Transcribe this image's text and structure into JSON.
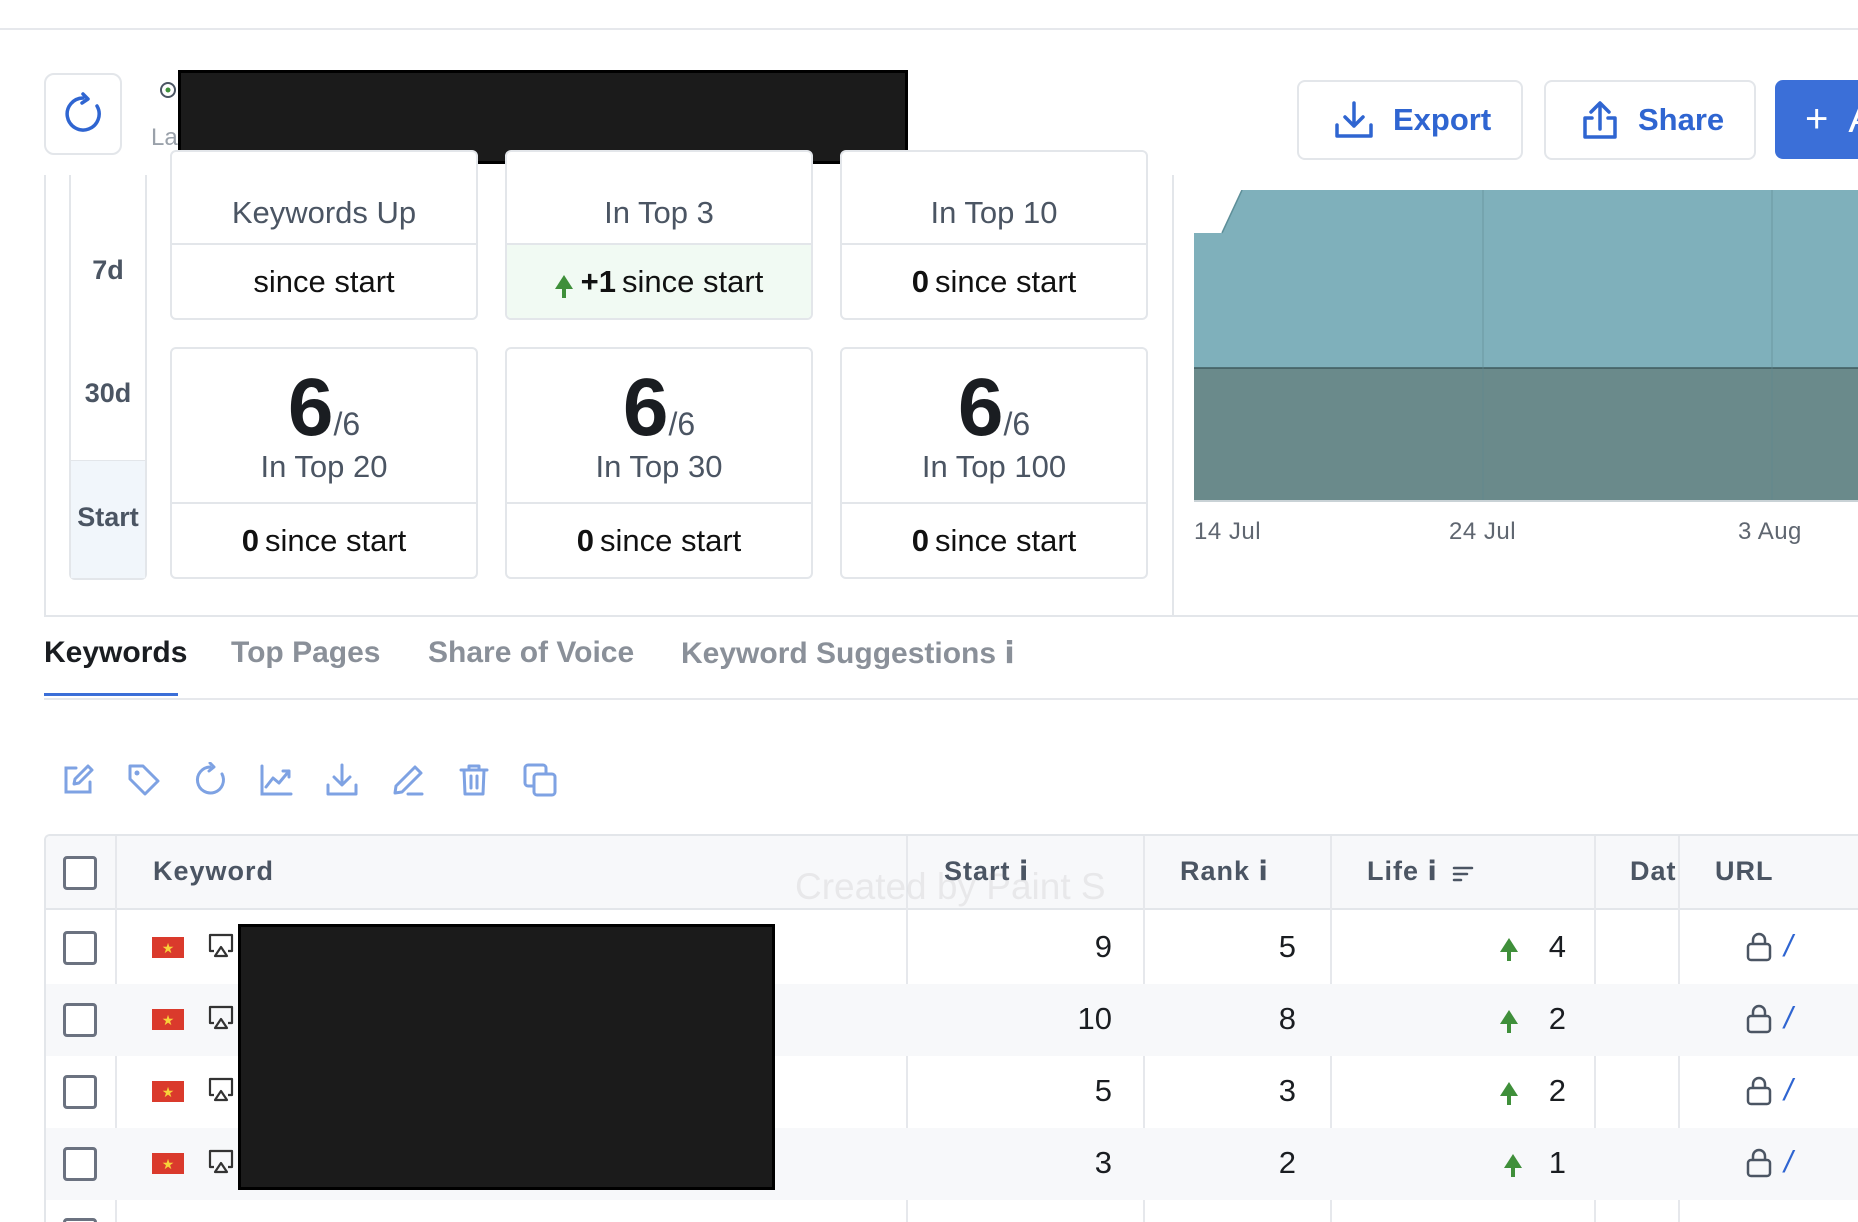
{
  "header": {
    "location_label": "La",
    "export_label": "Export",
    "share_label": "Share",
    "add_label": "A"
  },
  "periods": [
    "7d",
    "30d",
    "Start"
  ],
  "cards_row1": [
    {
      "title": "Keywords Up",
      "foot_value": "",
      "foot_text": "since start",
      "trend": "none"
    },
    {
      "title": "In Top 3",
      "foot_value": "+1",
      "foot_text": "since start",
      "trend": "up"
    },
    {
      "title": "In Top 10",
      "foot_value": "0",
      "foot_text": "since start",
      "trend": "none"
    }
  ],
  "cards_row2": [
    {
      "count": "6",
      "total": "/6",
      "title": "In Top 20",
      "foot_value": "0",
      "foot_text": "since start"
    },
    {
      "count": "6",
      "total": "/6",
      "title": "In Top 30",
      "foot_value": "0",
      "foot_text": "since start"
    },
    {
      "count": "6",
      "total": "/6",
      "title": "In Top 100",
      "foot_value": "0",
      "foot_text": "since start"
    }
  ],
  "chart": {
    "x_labels": [
      "14 Jul",
      "24 Jul",
      "3 Aug"
    ],
    "colors": {
      "upper": "#7fb0bb",
      "lower": "#6a8a8b"
    }
  },
  "tabs": [
    {
      "label": "Keywords",
      "active": true
    },
    {
      "label": "Top Pages",
      "active": false
    },
    {
      "label": "Share of Voice",
      "active": false
    },
    {
      "label": "Keyword Suggestions ⅰ",
      "active": false
    }
  ],
  "toolbar": [
    "edit-icon",
    "tag-icon",
    "refresh-icon",
    "chart-icon",
    "download-icon",
    "pencil-icon",
    "trash-icon",
    "copy-icon"
  ],
  "table": {
    "headers": {
      "keyword": "Keyword",
      "start": "Start ⅰ",
      "rank": "Rank ⅰ",
      "life": "Life ⅰ",
      "date": "Dat",
      "url": "URL"
    },
    "rows": [
      {
        "start": "9",
        "rank": "5",
        "life": "4",
        "url": "/"
      },
      {
        "start": "10",
        "rank": "8",
        "life": "2",
        "url": "/"
      },
      {
        "start": "5",
        "rank": "3",
        "life": "2",
        "url": "/"
      },
      {
        "start": "3",
        "rank": "2",
        "life": "1",
        "url": "/"
      }
    ]
  },
  "colors": {
    "accent": "#3b6fd8",
    "up_green": "#3f8f3a",
    "border": "#e3e6ea"
  },
  "watermark": "Created by Paint S"
}
